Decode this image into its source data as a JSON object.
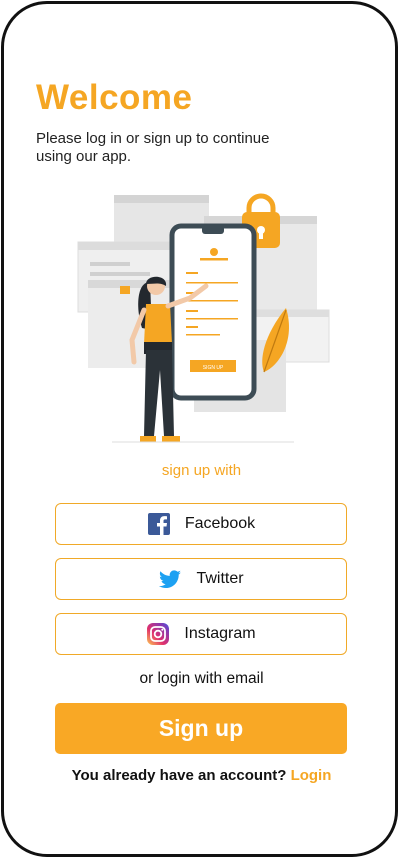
{
  "header": {
    "title": "Welcome",
    "subtitle": "Please log in or sign up to continue using our app."
  },
  "illustration": {
    "signup_button_text": "SIGN UP"
  },
  "social": {
    "heading": "sign up with",
    "buttons": [
      {
        "label": "Facebook",
        "icon": "facebook-icon"
      },
      {
        "label": "Twitter",
        "icon": "twitter-icon"
      },
      {
        "label": "Instagram",
        "icon": "instagram-icon"
      }
    ]
  },
  "email": {
    "label": "or login with email"
  },
  "signup": {
    "label": "Sign up"
  },
  "account": {
    "prompt": "You already have an account?",
    "login_label": "Login"
  },
  "colors": {
    "accent": "#f5a623",
    "button": "#f9a825",
    "facebook": "#3b5998",
    "twitter": "#1da1f2"
  }
}
